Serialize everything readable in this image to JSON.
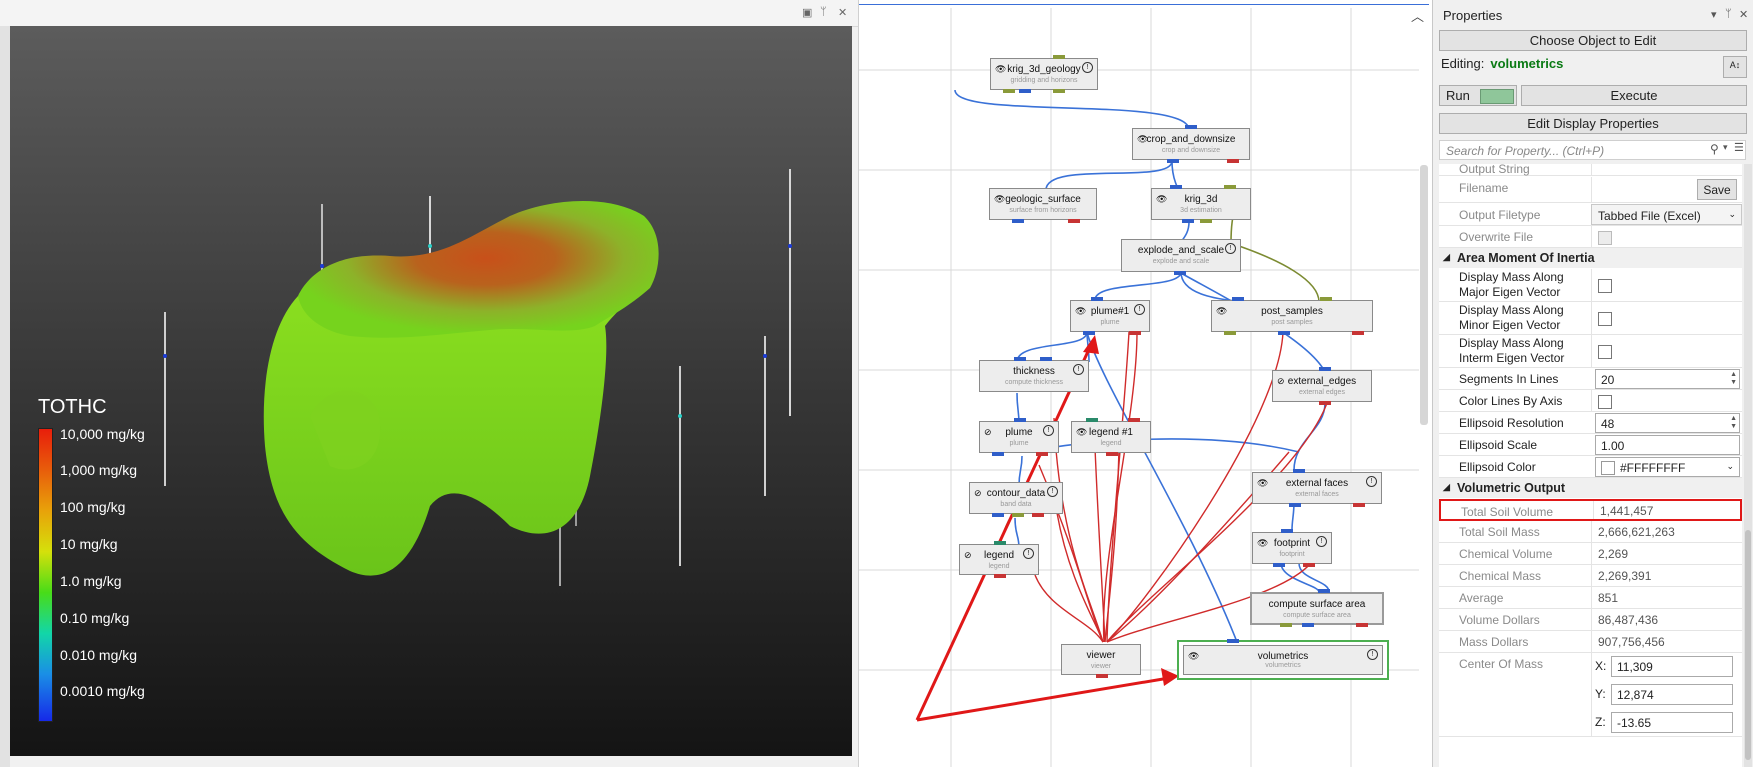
{
  "viewer": {
    "legend": {
      "title": "TOTHC",
      "labels": [
        "10,000 mg/kg",
        "1,000 mg/kg",
        "100 mg/kg",
        "10 mg/kg",
        "1.0 mg/kg",
        "0.10 mg/kg",
        "0.010 mg/kg",
        "0.0010 mg/kg"
      ]
    }
  },
  "graph": {
    "nodes": {
      "krig_3d_geology": {
        "title": "krig_3d_geology",
        "sub": "gridding and horizons"
      },
      "crop_and_downsize": {
        "title": "crop_and_downsize",
        "sub": "crop and downsize"
      },
      "geologic_surface": {
        "title": "geologic_surface",
        "sub": "surface from horizons"
      },
      "krig_3d": {
        "title": "krig_3d",
        "sub": "3d estimation"
      },
      "explode_and_scale": {
        "title": "explode_and_scale",
        "sub": "explode and scale"
      },
      "plume1": {
        "title": "plume#1",
        "sub": "plume"
      },
      "post_samples": {
        "title": "post_samples",
        "sub": "post samples"
      },
      "thickness": {
        "title": "thickness",
        "sub": "compute thickness"
      },
      "external_edges": {
        "title": "external_edges",
        "sub": "external edges"
      },
      "plume": {
        "title": "plume",
        "sub": "plume"
      },
      "legend1": {
        "title": "legend #1",
        "sub": "legend"
      },
      "external_faces": {
        "title": "external faces",
        "sub": "external faces"
      },
      "contour_data": {
        "title": "contour_data",
        "sub": "band data"
      },
      "footprint": {
        "title": "footprint",
        "sub": "footprint"
      },
      "legend": {
        "title": "legend",
        "sub": "legend"
      },
      "compute_surface_area": {
        "title": "compute surface area",
        "sub": "compute surface area"
      },
      "viewer": {
        "title": "viewer",
        "sub": "viewer"
      },
      "volumetrics": {
        "title": "volumetrics",
        "sub": "volumetrics"
      }
    }
  },
  "props": {
    "title": "Properties",
    "choose_object": "Choose Object to Edit",
    "editing_label": "Editing:",
    "editing_name": "volumetrics",
    "run_label": "Run",
    "execute": "Execute",
    "edit_display": "Edit Display Properties",
    "search_placeholder": "Search for Property...  (Ctrl+P)",
    "output_string": "Output String",
    "filename": "Filename",
    "save": "Save",
    "output_filetype": "Output Filetype",
    "output_filetype_value": "Tabbed File (Excel)",
    "overwrite_file": "Overwrite File",
    "section_area_moment": "Area Moment Of Inertia",
    "display_major_1": "Display Mass Along",
    "display_major_2": "Major Eigen Vector",
    "display_minor_1": "Display Mass Along",
    "display_minor_2": "Minor Eigen Vector",
    "display_interm_1": "Display Mass Along",
    "display_interm_2": "Interm Eigen Vector",
    "segments_in_lines": "Segments In Lines",
    "segments_value": "20",
    "color_lines_by_axis": "Color Lines By Axis",
    "ellipsoid_resolution": "Ellipsoid Resolution",
    "ellipsoid_resolution_value": "48",
    "ellipsoid_scale": "Ellipsoid Scale",
    "ellipsoid_scale_value": "1.00",
    "ellipsoid_color": "Ellipsoid Color",
    "ellipsoid_color_value": "#FFFFFFFF",
    "section_volumetric": "Volumetric Output",
    "total_soil_volume": "Total Soil Volume",
    "total_soil_volume_value": "1,441,457",
    "total_soil_mass": "Total Soil Mass",
    "total_soil_mass_value": "2,666,621,263",
    "chemical_volume": "Chemical Volume",
    "chemical_volume_value": "2,269",
    "chemical_mass": "Chemical Mass",
    "chemical_mass_value": "2,269,391",
    "average": "Average",
    "average_value": "851",
    "volume_dollars": "Volume Dollars",
    "volume_dollars_value": "86,487,436",
    "mass_dollars": "Mass Dollars",
    "mass_dollars_value": "907,756,456",
    "center_of_mass": "Center Of Mass",
    "x_label": "X:",
    "x_value": "11,309",
    "y_label": "Y:",
    "y_value": "12,874",
    "z_label": "Z:",
    "z_value": "-13.65"
  },
  "colors": {
    "highlight_red": "#e01818",
    "selected_node_green": "#4caf50",
    "run_swatch": "#8fc69a",
    "editing_name": "#0a7a14"
  },
  "icons": [
    "eye-icon",
    "hidden-eye-icon",
    "info-icon",
    "pin-icon",
    "close-icon",
    "search-icon",
    "list-icon",
    "collapse-arrow-icon",
    "sort-icon"
  ]
}
